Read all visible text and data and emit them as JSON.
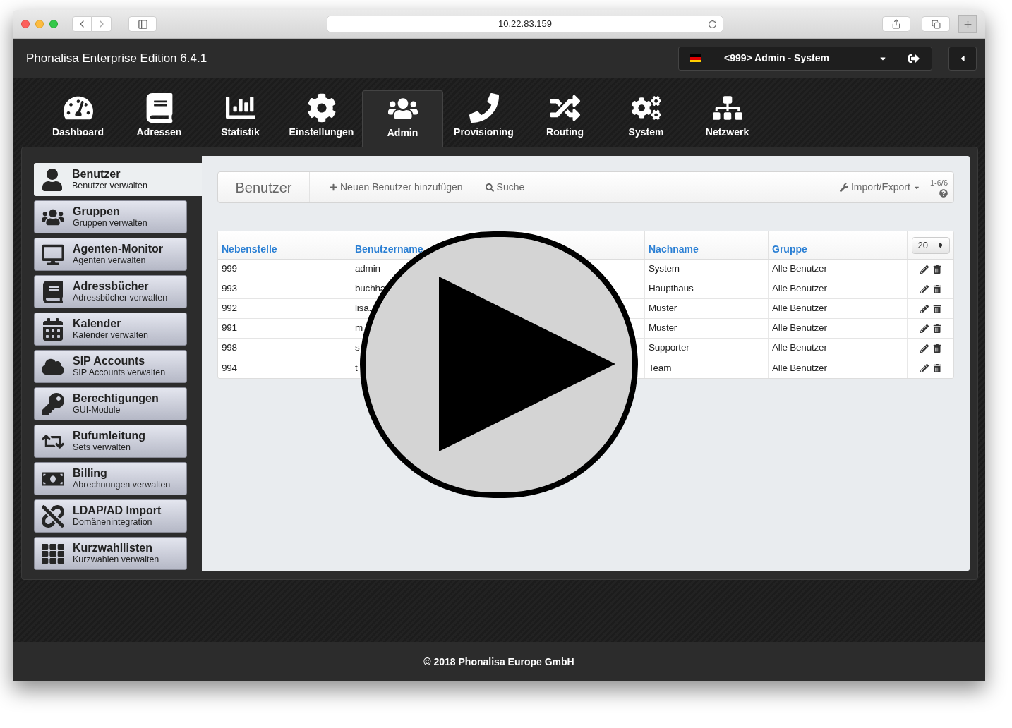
{
  "browser": {
    "url": "10.22.83.159"
  },
  "header": {
    "title": "Phonalisa Enterprise Edition 6.4.1",
    "user_menu": "<999> Admin - System"
  },
  "nav": [
    {
      "label": "Dashboard",
      "selected": false
    },
    {
      "label": "Adressen",
      "selected": false
    },
    {
      "label": "Statistik",
      "selected": false
    },
    {
      "label": "Einstellungen",
      "selected": false
    },
    {
      "label": "Admin",
      "selected": true
    },
    {
      "label": "Provisioning",
      "selected": false
    },
    {
      "label": "Routing",
      "selected": false
    },
    {
      "label": "System",
      "selected": false
    },
    {
      "label": "Netzwerk",
      "selected": false
    }
  ],
  "sidebar": {
    "items": [
      {
        "title": "Benutzer",
        "subtitle": "Benutzer verwalten",
        "selected": true
      },
      {
        "title": "Gruppen",
        "subtitle": "Gruppen verwalten",
        "selected": false
      },
      {
        "title": "Agenten-Monitor",
        "subtitle": "Agenten verwalten",
        "selected": false
      },
      {
        "title": "Adressbücher",
        "subtitle": "Adressbücher verwalten",
        "selected": false
      },
      {
        "title": "Kalender",
        "subtitle": "Kalender verwalten",
        "selected": false
      },
      {
        "title": "SIP Accounts",
        "subtitle": "SIP Accounts verwalten",
        "selected": false
      },
      {
        "title": "Berechtigungen",
        "subtitle": "GUI-Module",
        "selected": false
      },
      {
        "title": "Rufumleitung",
        "subtitle": "Sets verwalten",
        "selected": false
      },
      {
        "title": "Billing",
        "subtitle": "Abrechnungen verwalten",
        "selected": false
      },
      {
        "title": "LDAP/AD Import",
        "subtitle": "Domänenintegration",
        "selected": false
      },
      {
        "title": "Kurzwahllisten",
        "subtitle": "Kurzwahlen verwalten",
        "selected": false
      }
    ]
  },
  "toolbar": {
    "title": "Benutzer",
    "add": "Neuen Benutzer hinzufügen",
    "search": "Suche",
    "import_export": "Import/Export",
    "range": "1-6/6"
  },
  "table": {
    "columns": [
      "Nebenstelle",
      "Benutzername",
      "Nachname",
      "Gruppe"
    ],
    "page_size": "20",
    "rows": [
      [
        "999",
        "admin",
        "System",
        "Alle Benutzer"
      ],
      [
        "993",
        "buchha",
        "Haupthaus",
        "Alle Benutzer"
      ],
      [
        "992",
        "lisa.",
        "Muster",
        "Alle Benutzer"
      ],
      [
        "991",
        "m",
        "Muster",
        "Alle Benutzer"
      ],
      [
        "998",
        "s",
        "Supporter",
        "Alle Benutzer"
      ],
      [
        "994",
        "t",
        "Team",
        "Alle Benutzer"
      ]
    ]
  },
  "footer": "© 2018 Phonalisa Europe GmbH"
}
